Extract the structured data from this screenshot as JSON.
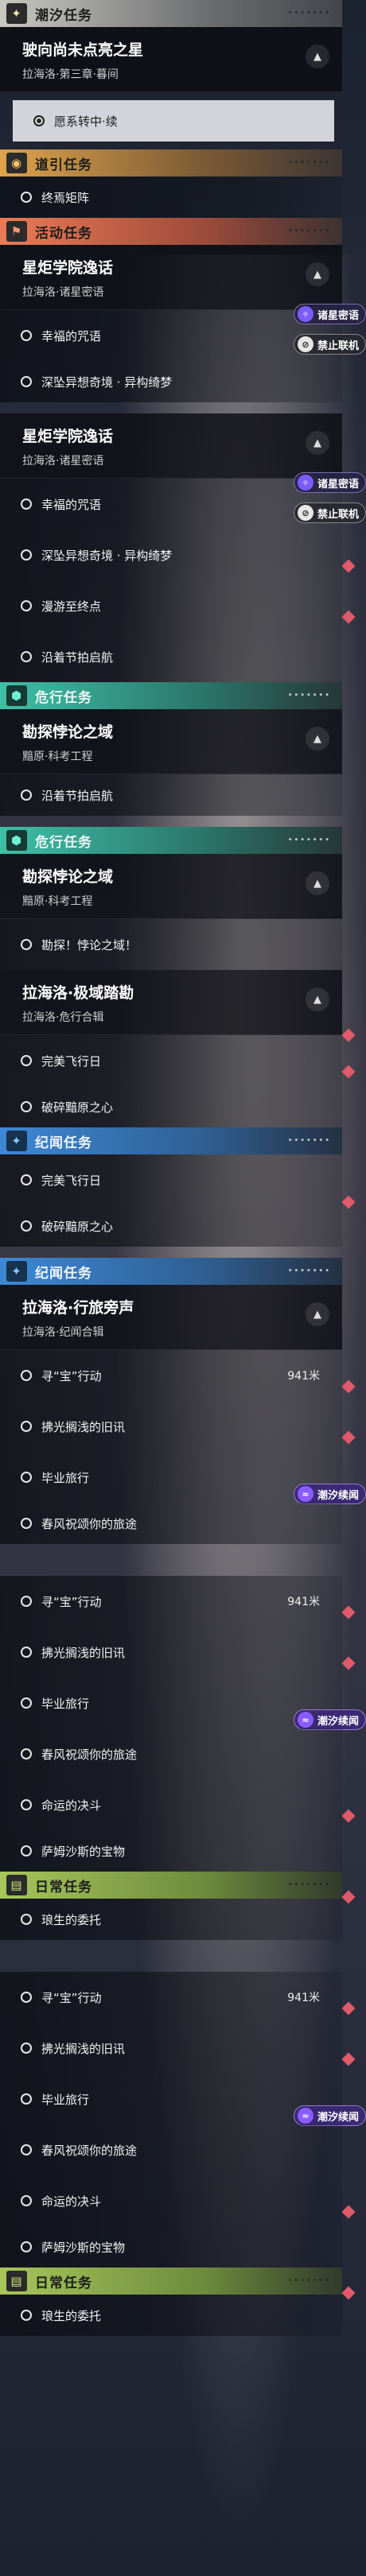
{
  "icons": {
    "tide": "crown-icon",
    "guide": "pin-icon",
    "event": "flag-icon",
    "danger": "shield-icon",
    "saga": "star-icon",
    "daily": "calendar-icon"
  },
  "s1": {
    "label": "潮汐任务",
    "card_title": "驶向尚未点亮之星",
    "card_sub": "拉海洛·第三章·暮间",
    "item": "愿系转中·续"
  },
  "s2": {
    "label": "道引任务",
    "item": "终焉矩阵"
  },
  "s3": {
    "label": "活动任务",
    "card_title": "星炬学院逸话",
    "card_sub": "拉海洛·诸星密语",
    "items": [
      "幸福的咒语",
      "深坠异想奇境 · 异构绮梦"
    ],
    "badge1": "诸星密语",
    "badge2": "禁止联机"
  },
  "s4": {
    "card_title": "星炬学院逸话",
    "card_sub": "拉海洛·诸星密语",
    "items": [
      "幸福的咒语",
      "深坠异想奇境 · 异构绮梦",
      "漫游至终点",
      "沿着节拍启航"
    ],
    "badge1": "诸星密语",
    "badge2": "禁止联机"
  },
  "s5": {
    "label": "危行任务",
    "card_title": "勘探悖论之域",
    "card_sub": "黯原·科考工程",
    "tail": "沿着节拍启航"
  },
  "s6": {
    "label": "危行任务",
    "card_title": "勘探悖论之域",
    "card_sub": "黯原·科考工程",
    "item": "勘探！悖论之域！",
    "card2_title": "拉海洛·极域踏勘",
    "card2_sub": "拉海洛·危行合辑",
    "items": [
      "完美飞行日",
      "破碎黯原之心"
    ]
  },
  "s7": {
    "label": "纪闻任务",
    "items": [
      "完美飞行日",
      "破碎黯原之心"
    ]
  },
  "s8": {
    "label": "纪闻任务",
    "card_title": "拉海洛·行旅旁声",
    "card_sub": "拉海洛·纪闻合辑",
    "items": [
      "寻“宝”行动",
      "拂光搁浅的旧讯",
      "毕业旅行",
      "春风祝颂你的旅途"
    ],
    "dist": "941米",
    "badge": "潮汐续闻"
  },
  "s9": {
    "items": [
      "寻“宝”行动",
      "拂光搁浅的旧讯",
      "毕业旅行",
      "春风祝颂你的旅途",
      "命运的决斗",
      "萨姆沙斯的宝物"
    ],
    "dist": "941米",
    "badge": "潮汐续闻",
    "daily_label": "日常任务",
    "daily_item": "琅生的委托"
  },
  "s10": {
    "items": [
      "寻“宝”行动",
      "拂光搁浅的旧讯",
      "毕业旅行",
      "春风祝颂你的旅途",
      "命运的决斗",
      "萨姆沙斯的宝物"
    ],
    "dist": "941米",
    "badge": "潮汐续闻",
    "daily_label": "日常任务",
    "daily_item": "琅生的委托"
  }
}
